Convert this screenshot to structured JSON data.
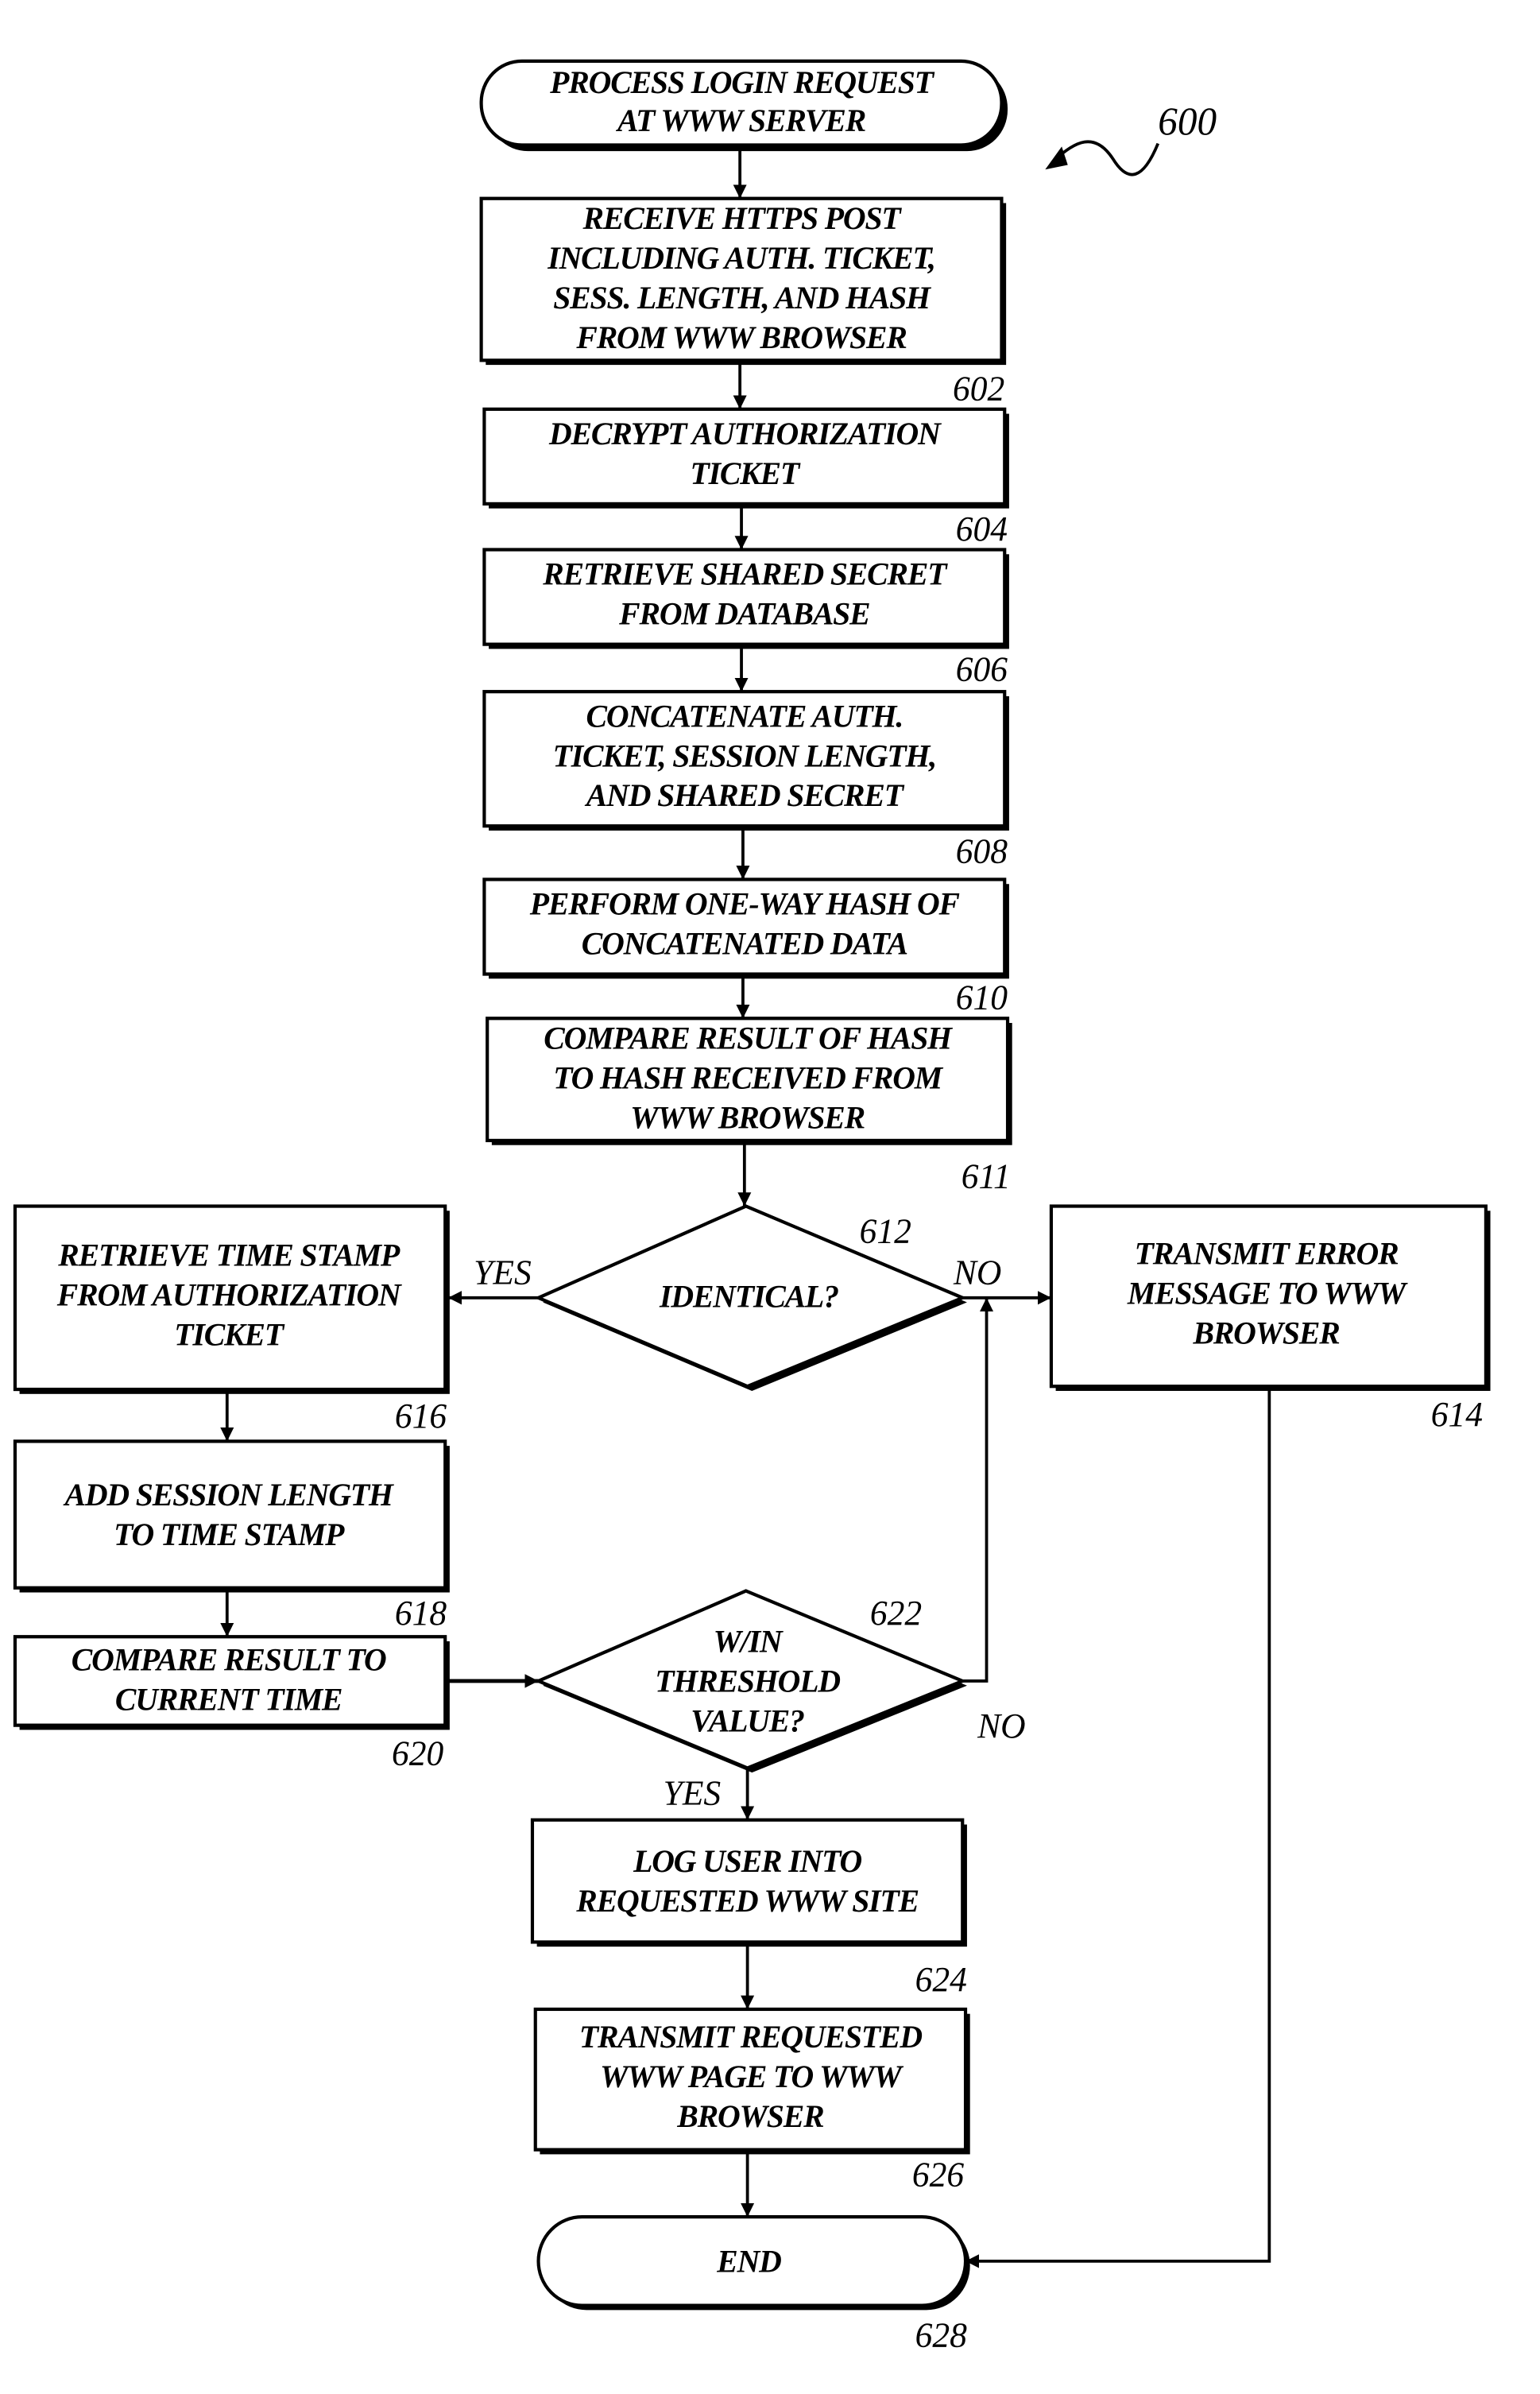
{
  "figure": {
    "number": "600"
  },
  "nodes": {
    "start": {
      "lines": [
        "PROCESS LOGIN REQUEST",
        "AT WWW SERVER"
      ]
    },
    "n602": {
      "ref": "602",
      "lines": [
        "RECEIVE HTTPS POST",
        "INCLUDING AUTH. TICKET,",
        "SESS. LENGTH, AND HASH",
        "FROM WWW BROWSER"
      ]
    },
    "n604": {
      "ref": "604",
      "lines": [
        "DECRYPT AUTHORIZATION",
        "TICKET"
      ]
    },
    "n606": {
      "ref": "606",
      "lines": [
        "RETRIEVE SHARED SECRET",
        "FROM DATABASE"
      ]
    },
    "n608": {
      "ref": "608",
      "lines": [
        "CONCATENATE AUTH.",
        "TICKET, SESSION LENGTH,",
        "AND SHARED SECRET"
      ]
    },
    "n610": {
      "ref": "610",
      "lines": [
        "PERFORM ONE-WAY HASH OF",
        "CONCATENATED DATA"
      ]
    },
    "n611": {
      "ref": "611",
      "lines": [
        "COMPARE RESULT OF HASH",
        "TO HASH RECEIVED FROM",
        "WWW BROWSER"
      ]
    },
    "n612": {
      "ref": "612",
      "lines": [
        "IDENTICAL?"
      ],
      "yes": "YES",
      "no": "NO"
    },
    "n614": {
      "ref": "614",
      "lines": [
        "TRANSMIT ERROR",
        "MESSAGE TO WWW",
        "BROWSER"
      ]
    },
    "n616": {
      "ref": "616",
      "lines": [
        "RETRIEVE TIME STAMP",
        "FROM AUTHORIZATION",
        "TICKET"
      ]
    },
    "n618": {
      "ref": "618",
      "lines": [
        "ADD SESSION LENGTH",
        "TO TIME STAMP"
      ]
    },
    "n620": {
      "ref": "620",
      "lines": [
        "COMPARE RESULT TO",
        "CURRENT TIME"
      ]
    },
    "n622": {
      "ref": "622",
      "lines": [
        "W/IN",
        "THRESHOLD",
        "VALUE?"
      ],
      "yes": "YES",
      "no": "NO"
    },
    "n624": {
      "ref": "624",
      "lines": [
        "LOG USER INTO",
        "REQUESTED WWW SITE"
      ]
    },
    "n626": {
      "ref": "626",
      "lines": [
        "TRANSMIT REQUESTED",
        "WWW PAGE TO WWW",
        "BROWSER"
      ]
    },
    "end": {
      "ref": "628",
      "lines": [
        "END"
      ]
    }
  }
}
